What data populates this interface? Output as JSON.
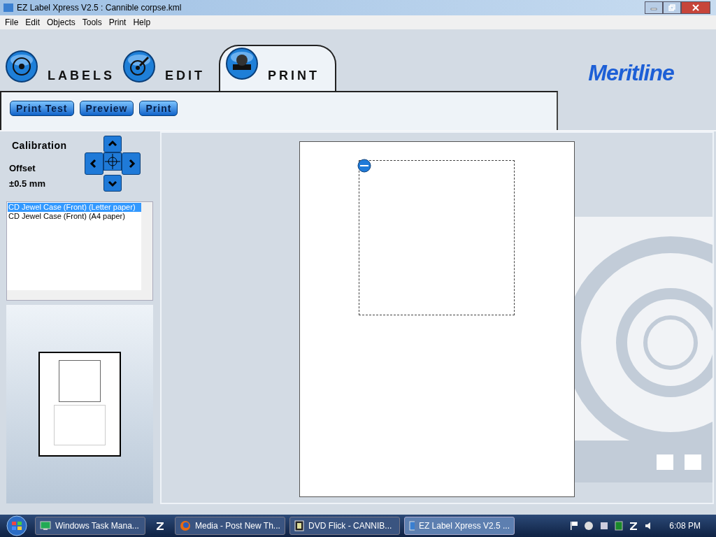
{
  "window": {
    "title": "EZ Label Xpress V2.5 : Cannible corpse.kml"
  },
  "menu": [
    "File",
    "Edit",
    "Objects",
    "Tools",
    "Print",
    "Help"
  ],
  "tabs": [
    {
      "label": "LABELS",
      "kind": "disc",
      "selected": false
    },
    {
      "label": "EDIT",
      "kind": "pen",
      "selected": false
    },
    {
      "label": "PRINT",
      "kind": "printer",
      "selected": true
    }
  ],
  "logo": "Meritline",
  "toolbar": [
    "Print Test",
    "Preview",
    "Print"
  ],
  "calibration": {
    "title": "Calibration",
    "offset_label": "Offset",
    "offset_value": "±0.5 mm"
  },
  "templates": [
    {
      "label": "CD Jewel Case (Front) (Letter paper)",
      "selected": true
    },
    {
      "label": "CD Jewel Case (Front) (A4 paper)",
      "selected": false
    }
  ],
  "taskbar": [
    {
      "label": "Windows Task Mana...",
      "kind": "monitor",
      "selected": false
    },
    {
      "kind": "zone",
      "selected": false
    },
    {
      "label": "Media - Post New Th...",
      "kind": "browser",
      "selected": false
    },
    {
      "label": "DVD Flick - CANNIB...",
      "kind": "film",
      "selected": false
    },
    {
      "label": "EZ Label Xpress V2.5 ...",
      "kind": "app",
      "selected": true
    }
  ],
  "clock": "6:08 PM"
}
